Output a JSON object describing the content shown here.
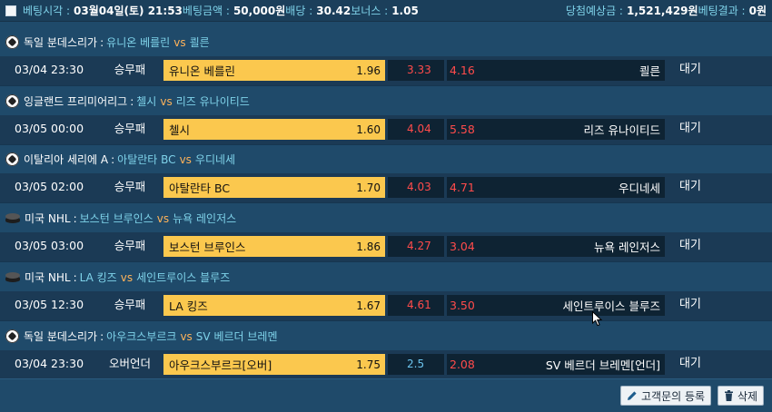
{
  "header": {
    "bet_time_label": "베팅시각 :",
    "bet_time_value": "03월04일(토) 21:53",
    "bet_amount_label": "베팅금액 :",
    "bet_amount_value": "50,000원",
    "odds_label": "배당 :",
    "odds_value": "30.42",
    "bonus_label": "보너스 :",
    "bonus_value": "1.05",
    "expected_win_label": "당첨예상금 :",
    "expected_win_value": "1,521,429원",
    "result_label": "베팅결과 :",
    "result_value": "0원"
  },
  "matches": [
    {
      "icon": "soccer-ball-icon",
      "league": "독일 분데스리가",
      "home_team": "유니온 베를린",
      "vs": "vs",
      "away_team": "쾰른",
      "datetime": "03/04 23:30",
      "bet_type": "승무패",
      "home_label": "유니온 베를린",
      "home_odd": "1.96",
      "draw_odd": "3.33",
      "away_odd": "4.16",
      "away_label": "쾰른",
      "status": "대기"
    },
    {
      "icon": "soccer-ball-icon",
      "league": "잉글랜드 프리미어리그",
      "home_team": "첼시",
      "vs": "vs",
      "away_team": "리즈 유나이티드",
      "datetime": "03/05 00:00",
      "bet_type": "승무패",
      "home_label": "첼시",
      "home_odd": "1.60",
      "draw_odd": "4.04",
      "away_odd": "5.58",
      "away_label": "리즈 유나이티드",
      "status": "대기"
    },
    {
      "icon": "soccer-ball-icon",
      "league": "이탈리아 세리에 A",
      "home_team": "아탈란타 BC",
      "vs": "vs",
      "away_team": "우디네세",
      "datetime": "03/05 02:00",
      "bet_type": "승무패",
      "home_label": "아탈란타 BC",
      "home_odd": "1.70",
      "draw_odd": "4.03",
      "away_odd": "4.71",
      "away_label": "우디네세",
      "status": "대기"
    },
    {
      "icon": "hockey-puck-icon",
      "league": "미국 NHL",
      "home_team": "보스턴 브루인스",
      "vs": "vs",
      "away_team": "뉴욕 레인저스",
      "datetime": "03/05 03:00",
      "bet_type": "승무패",
      "home_label": "보스턴 브루인스",
      "home_odd": "1.86",
      "draw_odd": "4.27",
      "away_odd": "3.04",
      "away_label": "뉴욕 레인저스",
      "status": "대기"
    },
    {
      "icon": "hockey-puck-icon",
      "league": "미국 NHL",
      "home_team": "LA 킹즈",
      "vs": "vs",
      "away_team": "세인트루이스 블루즈",
      "datetime": "03/05 12:30",
      "bet_type": "승무패",
      "home_label": "LA 킹즈",
      "home_odd": "1.67",
      "draw_odd": "4.61",
      "away_odd": "3.50",
      "away_label": "세인트루이스 블루즈",
      "status": "대기"
    },
    {
      "icon": "soccer-ball-icon",
      "league": "독일 분데스리가",
      "home_team": "아우크스부르크",
      "vs": "vs",
      "away_team": "SV 베르더 브레멘",
      "datetime": "03/04 23:30",
      "bet_type": "오버언더",
      "home_label": "아우크스부르크[오버]",
      "home_odd": "1.75",
      "draw_odd": "2.5",
      "away_odd": "2.08",
      "away_label": "SV 베르더 브레멘[언더]",
      "status": "대기"
    }
  ],
  "footer": {
    "register_inquiry_label": "고객문의 등록",
    "delete_label": "삭제"
  },
  "colors": {
    "accent_blue": "#7fd3ea",
    "odd_red": "#ff4b4b",
    "highlight_yellow": "#fbc84e",
    "vs_orange": "#ffb35a"
  }
}
